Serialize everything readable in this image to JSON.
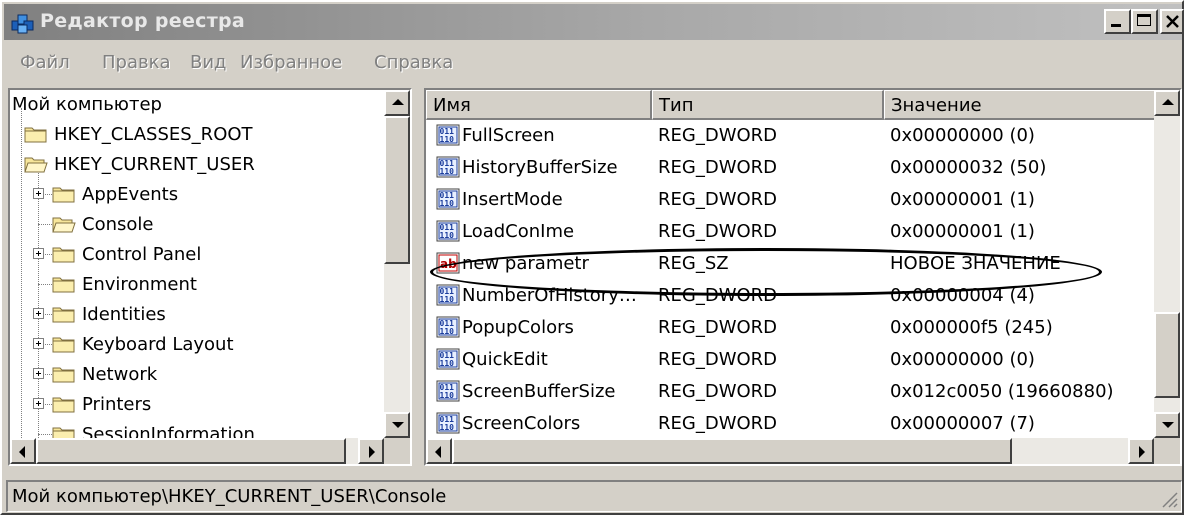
{
  "window": {
    "title": "Редактор реестра"
  },
  "menu": [
    "Файл",
    "Правка",
    "Вид",
    "Избранное",
    "Справка"
  ],
  "tree": {
    "root": "Мой компьютер",
    "items": [
      {
        "label": "HKEY_CLASSES_ROOT",
        "level": 0,
        "expandable": false,
        "open": false
      },
      {
        "label": "HKEY_CURRENT_USER",
        "level": 0,
        "expandable": false,
        "open": true
      },
      {
        "label": "AppEvents",
        "level": 1,
        "expandable": true,
        "open": false
      },
      {
        "label": "Console",
        "level": 1,
        "expandable": false,
        "open": true
      },
      {
        "label": "Control Panel",
        "level": 1,
        "expandable": true,
        "open": false
      },
      {
        "label": "Environment",
        "level": 1,
        "expandable": false,
        "open": false
      },
      {
        "label": "Identities",
        "level": 1,
        "expandable": true,
        "open": false
      },
      {
        "label": "Keyboard Layout",
        "level": 1,
        "expandable": true,
        "open": false
      },
      {
        "label": "Network",
        "level": 1,
        "expandable": true,
        "open": false
      },
      {
        "label": "Printers",
        "level": 1,
        "expandable": true,
        "open": false
      },
      {
        "label": "SessionInformation",
        "level": 1,
        "expandable": false,
        "open": false
      }
    ]
  },
  "list": {
    "columns": [
      "Имя",
      "Тип",
      "Значение"
    ],
    "rows": [
      {
        "name": "FullScreen",
        "type": "REG_DWORD",
        "value": "0x00000000 (0)",
        "icon": "dword-value-icon"
      },
      {
        "name": "HistoryBufferSize",
        "type": "REG_DWORD",
        "value": "0x00000032 (50)",
        "icon": "dword-value-icon"
      },
      {
        "name": "InsertMode",
        "type": "REG_DWORD",
        "value": "0x00000001 (1)",
        "icon": "dword-value-icon"
      },
      {
        "name": "LoadConIme",
        "type": "REG_DWORD",
        "value": "0x00000001 (1)",
        "icon": "dword-value-icon"
      },
      {
        "name": "new parametr",
        "type": "REG_SZ",
        "value": "НОВОЕ ЗНАЧЕНИЕ",
        "icon": "string-value-icon"
      },
      {
        "name": "NumberOfHistory…",
        "type": "REG_DWORD",
        "value": "0x00000004 (4)",
        "icon": "dword-value-icon"
      },
      {
        "name": "PopupColors",
        "type": "REG_DWORD",
        "value": "0x000000f5 (245)",
        "icon": "dword-value-icon"
      },
      {
        "name": "QuickEdit",
        "type": "REG_DWORD",
        "value": "0x00000000 (0)",
        "icon": "dword-value-icon"
      },
      {
        "name": "ScreenBufferSize",
        "type": "REG_DWORD",
        "value": "0x012c0050 (19660880)",
        "icon": "dword-value-icon"
      },
      {
        "name": "ScreenColors",
        "type": "REG_DWORD",
        "value": "0x00000007 (7)",
        "icon": "dword-value-icon"
      }
    ]
  },
  "statusbar": {
    "path": "Мой компьютер\\HKEY_CURRENT_USER\\Console"
  }
}
